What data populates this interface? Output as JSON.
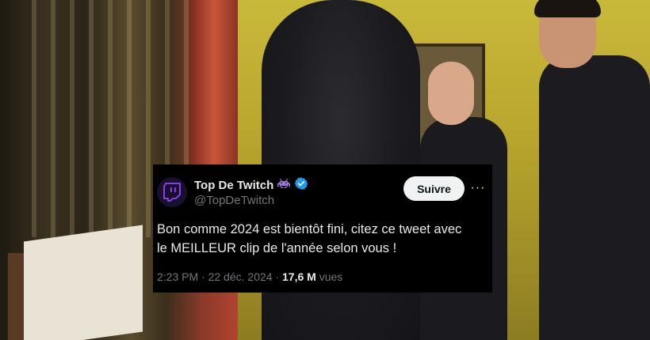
{
  "tweet": {
    "display_name": "Top De Twitch",
    "handle": "@TopDeTwitch",
    "follow_label": "Suivre",
    "more_label": "···",
    "text_line1": "Bon comme 2024 est bientôt fini, citez ce tweet avec",
    "text_line2": "le MEILLEUR clip de l'année selon vous !",
    "time": "2:23 PM",
    "separator": "·",
    "date": "22 déc. 2024",
    "views_count": "17,6 M",
    "views_label": "vues"
  },
  "colors": {
    "tweet_bg": "#000000",
    "text_primary": "#e7e9ea",
    "text_secondary": "#71767b",
    "verified_badge": "#1d9bf0",
    "twitch_purple": "#9146ff",
    "follow_button_bg": "#eff3f4"
  },
  "icons": {
    "avatar": "twitch-logo-icon",
    "emoji": "space-invader-icon",
    "verified": "verified-badge-icon"
  }
}
